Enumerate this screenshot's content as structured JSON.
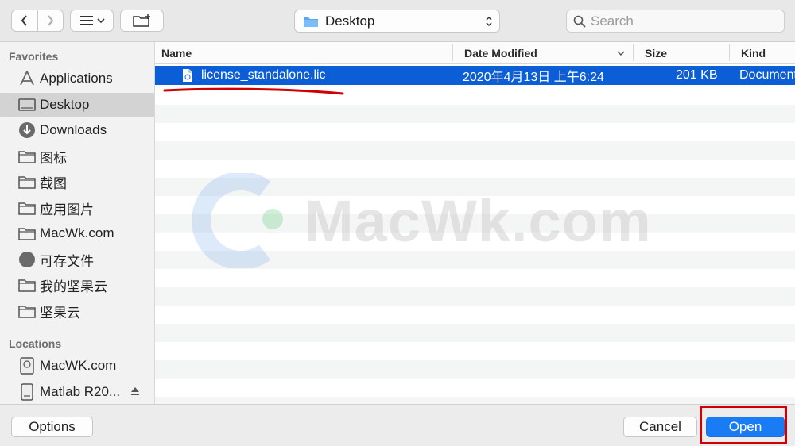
{
  "toolbar": {
    "location": "Desktop",
    "search_placeholder": "Search"
  },
  "sidebar": {
    "favorites_heading": "Favorites",
    "favorites": [
      {
        "label": "Applications",
        "icon": "applications-icon"
      },
      {
        "label": "Desktop",
        "icon": "desktop-icon",
        "selected": true
      },
      {
        "label": "Downloads",
        "icon": "downloads-icon"
      },
      {
        "label": "图标",
        "icon": "folder-icon"
      },
      {
        "label": "截图",
        "icon": "folder-icon"
      },
      {
        "label": "应用图片",
        "icon": "folder-icon"
      },
      {
        "label": "MacWk.com",
        "icon": "folder-icon"
      },
      {
        "label": "可存文件",
        "icon": "circle-icon"
      },
      {
        "label": "我的坚果云",
        "icon": "folder-icon"
      },
      {
        "label": "坚果云",
        "icon": "folder-icon"
      }
    ],
    "locations_heading": "Locations",
    "locations": [
      {
        "label": "MacWK.com",
        "icon": "hard-drive-icon"
      },
      {
        "label": "Matlab R20...",
        "icon": "disk-image-icon",
        "ejectable": true
      }
    ]
  },
  "file_list": {
    "columns": {
      "name": "Name",
      "date": "Date Modified",
      "size": "Size",
      "kind": "Kind"
    },
    "rows": [
      {
        "name": "license_standalone.lic",
        "date": "2020年4月13日 上午6:24",
        "size": "201 KB",
        "kind": "Document",
        "selected": true
      }
    ]
  },
  "watermark": "MacWk.com",
  "footer": {
    "options_label": "Options",
    "cancel_label": "Cancel",
    "open_label": "Open"
  },
  "colors": {
    "selection": "#0b5ed6",
    "primary_button": "#1a7cf5",
    "annotation_red": "#d00000"
  }
}
